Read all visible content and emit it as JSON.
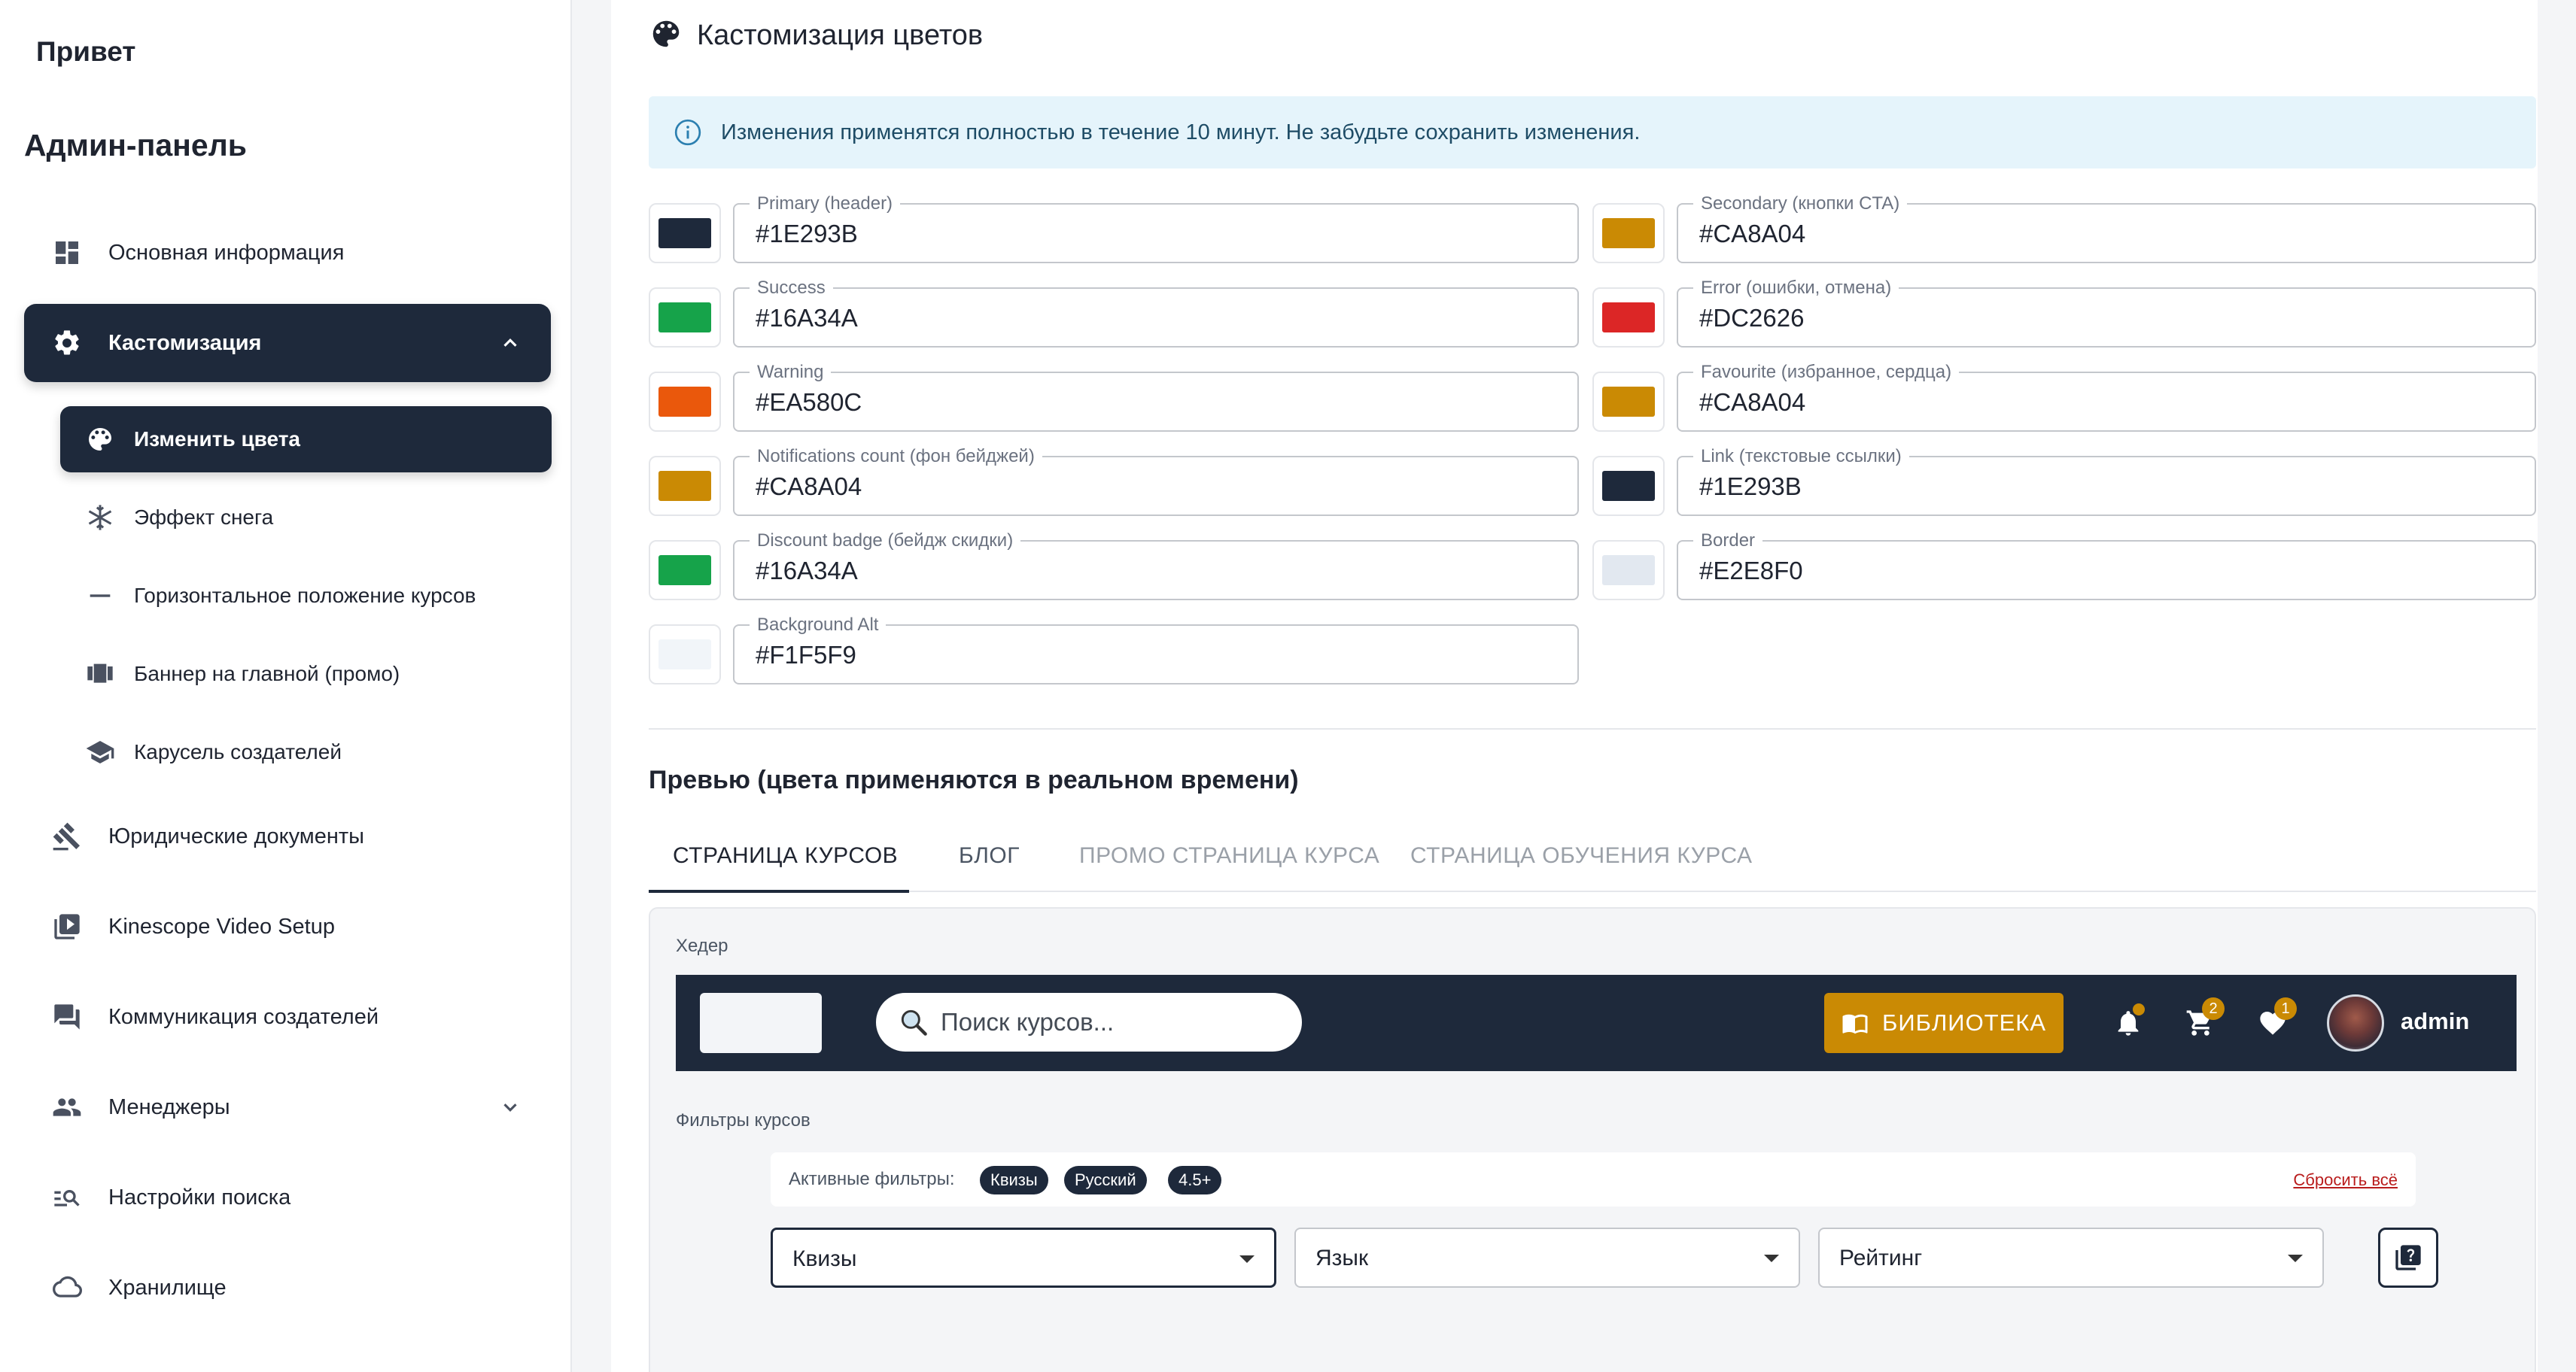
{
  "sidebar": {
    "greeting": "Привет",
    "title": "Админ-панель",
    "items": [
      {
        "label": "Основная информация",
        "icon": "dashboard-icon"
      },
      {
        "label": "Кастомизация",
        "icon": "gear-icon",
        "active": true,
        "expanded": true
      },
      {
        "label": "Юридические документы",
        "icon": "gavel-icon"
      },
      {
        "label": "Kinescope Video Setup",
        "icon": "video-library-icon"
      },
      {
        "label": "Коммуникация создателей",
        "icon": "chat-icon"
      },
      {
        "label": "Менеджеры",
        "icon": "people-icon",
        "expandable": true
      },
      {
        "label": "Настройки поиска",
        "icon": "manage-search-icon"
      },
      {
        "label": "Хранилище",
        "icon": "cloud-icon"
      }
    ],
    "subitems": [
      {
        "label": "Изменить цвета",
        "icon": "palette-icon",
        "active": true
      },
      {
        "label": "Эффект снега",
        "icon": "snowflake-icon"
      },
      {
        "label": "Горизонтальное положение курсов",
        "icon": "horizontal-rule-icon"
      },
      {
        "label": "Баннер на главной (промо)",
        "icon": "view-carousel-icon"
      },
      {
        "label": "Карусель создателей",
        "icon": "school-icon"
      }
    ]
  },
  "main": {
    "title": "Кастомизация цветов",
    "info": "Изменения применятся полностью в течение 10 минут. Не забудьте сохранить изменения.",
    "colors_left": [
      {
        "label": "Primary (header)",
        "value": "#1E293B"
      },
      {
        "label": "Success",
        "value": "#16A34A"
      },
      {
        "label": "Warning",
        "value": "#EA580C"
      },
      {
        "label": "Notifications count (фон бейджей)",
        "value": "#CA8A04"
      },
      {
        "label": "Discount badge (бейдж скидки)",
        "value": "#16A34A"
      },
      {
        "label": "Background Alt",
        "value": "#F1F5F9"
      }
    ],
    "colors_right": [
      {
        "label": "Secondary (кнопки CTA)",
        "value": "#CA8A04"
      },
      {
        "label": "Error (ошибки, отмена)",
        "value": "#DC2626"
      },
      {
        "label": "Favourite (избранное, сердца)",
        "value": "#CA8A04"
      },
      {
        "label": "Link (текстовые ссылки)",
        "value": "#1E293B"
      },
      {
        "label": "Border",
        "value": "#E2E8F0"
      }
    ],
    "preview_title": "Превью (цвета применяются в реальном времени)",
    "tabs": [
      {
        "label": "СТРАНИЦА КУРСОВ",
        "active": true
      },
      {
        "label": "БЛОГ"
      },
      {
        "label": "ПРОМО СТРАНИЦА КУРСА"
      },
      {
        "label": "СТРАНИЦА ОБУЧЕНИЯ КУРСА"
      }
    ],
    "preview": {
      "header_label": "Хедер",
      "search_placeholder": "Поиск курсов...",
      "library_label": "БИБЛИОТЕКА",
      "cart_count": "2",
      "favourites_count": "1",
      "username": "admin",
      "filters_label": "Фильтры курсов",
      "active_filters_label": "Активные фильтры:",
      "chips": [
        "Квизы",
        "Русский",
        "4.5+"
      ],
      "reset_label": "Сбросить всё",
      "selects": [
        "Квизы",
        "Язык",
        "Рейтинг"
      ]
    }
  }
}
